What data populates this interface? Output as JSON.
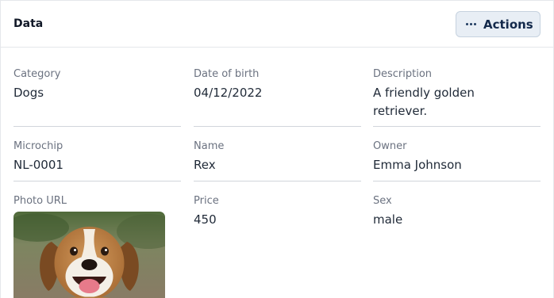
{
  "header": {
    "title": "Data",
    "actions_label": "Actions"
  },
  "fields": {
    "category": {
      "label": "Category",
      "value": "Dogs"
    },
    "date_of_birth": {
      "label": "Date of birth",
      "value": "04/12/2022"
    },
    "description": {
      "label": "Description",
      "value": "A friendly golden retriever."
    },
    "microchip": {
      "label": "Microchip",
      "value": "NL-0001"
    },
    "name": {
      "label": "Name",
      "value": "Rex"
    },
    "owner": {
      "label": "Owner",
      "value": "Emma Johnson"
    },
    "photo_url": {
      "label": "Photo URL"
    },
    "price": {
      "label": "Price",
      "value": "450"
    },
    "sex": {
      "label": "Sex",
      "value": "male"
    }
  },
  "colors": {
    "actions_bg": "#e8eef5",
    "actions_text": "#13294b",
    "divider": "#d1d5db"
  },
  "icons": [
    "more-dots-icon"
  ]
}
